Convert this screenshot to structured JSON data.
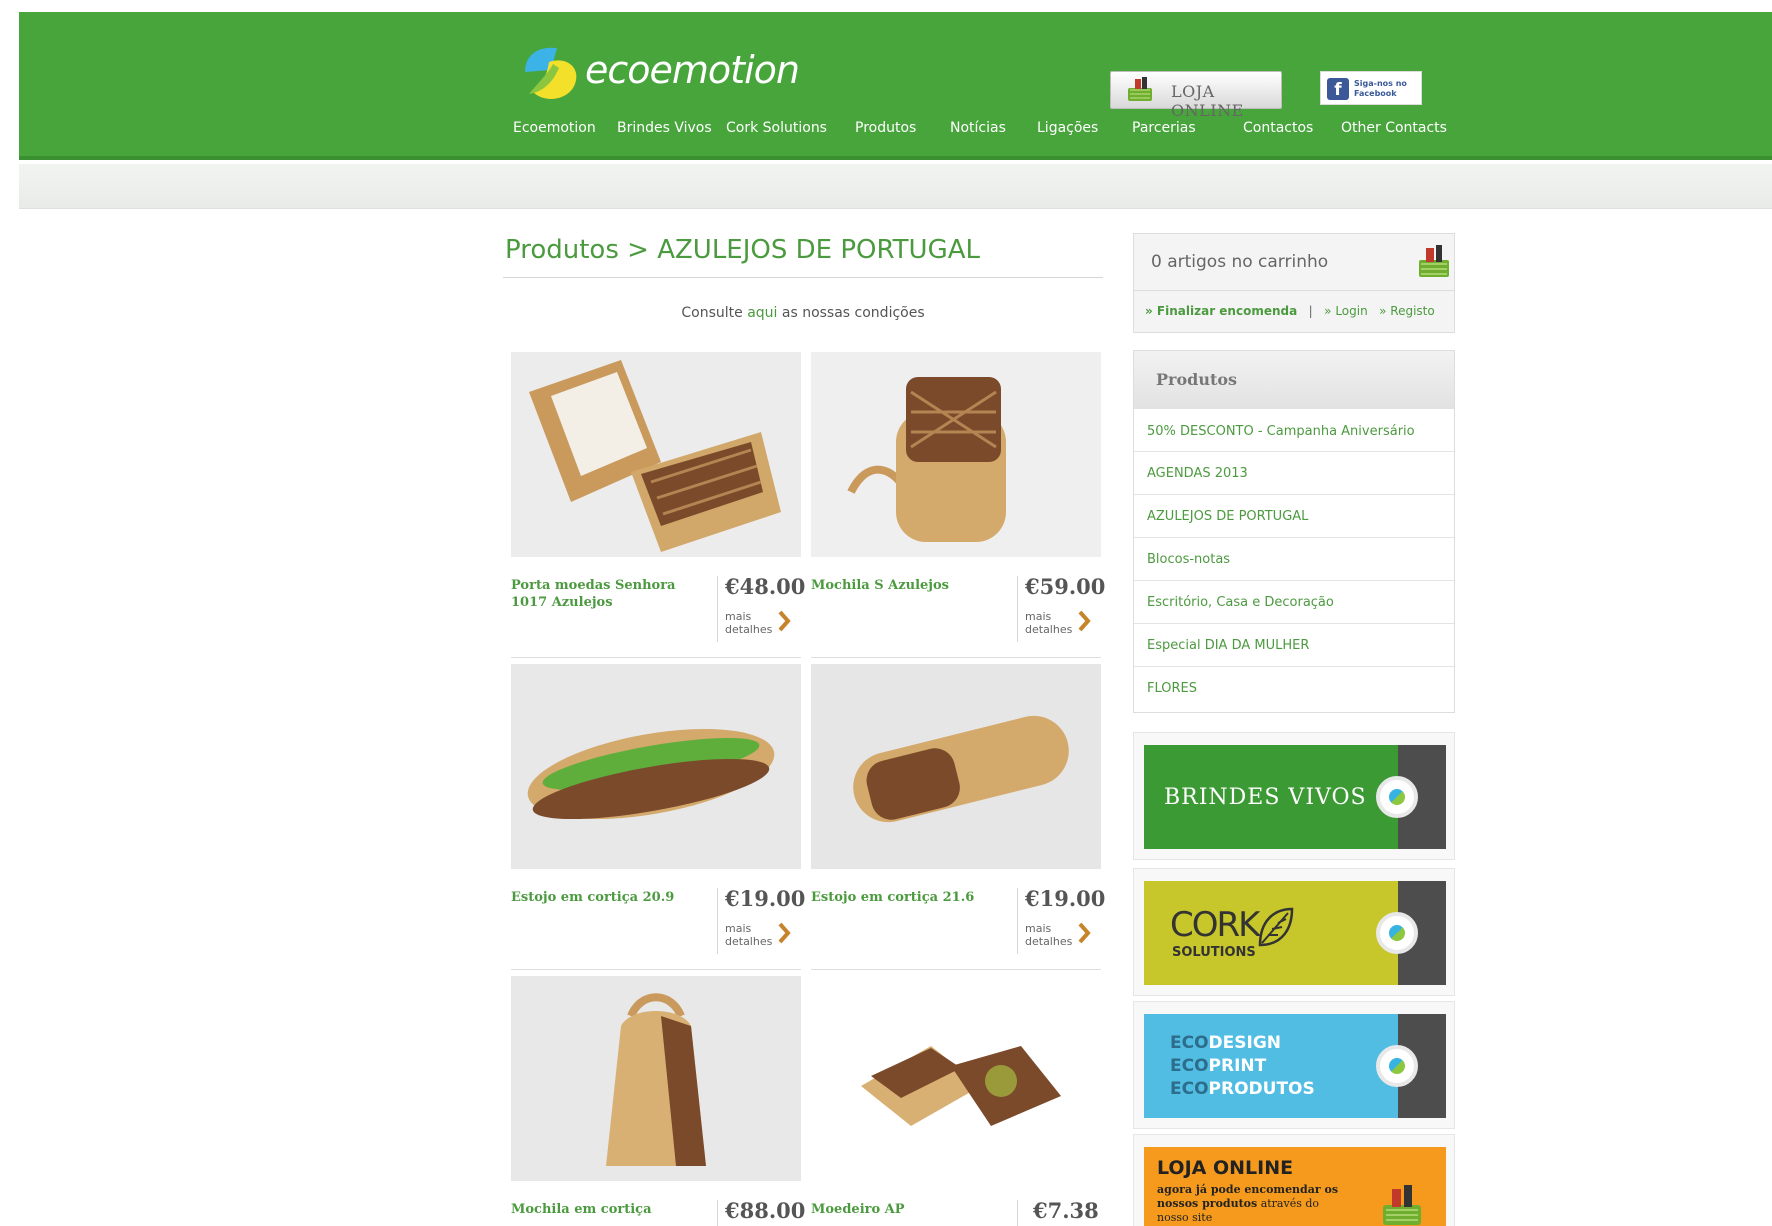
{
  "header": {
    "logo_text": "ecoemotion",
    "shop_button_label": "LOJA ONLINE",
    "facebook_label": "Siga-nos no Facebook",
    "nav": [
      "Ecoemotion",
      "Brindes Vivos",
      "Cork Solutions",
      "Produtos",
      "Notícias",
      "Ligações",
      "Parcerias",
      "Contactos",
      "Other Contacts"
    ]
  },
  "main": {
    "title": "Produtos > AZULEJOS DE PORTUGAL",
    "conditions_before": "Consulte ",
    "conditions_link": "aqui",
    "conditions_after": " as nossas condições",
    "more_label": "mais detalhes",
    "products": [
      {
        "name": "Porta moedas Senhora 1017 Azulejos",
        "price": "€48.00",
        "icon": "wallet"
      },
      {
        "name": "Mochila S Azulejos",
        "price": "€59.00",
        "icon": "backpack-small"
      },
      {
        "name": "Estojo em cortiça 20.9",
        "price": "€19.00",
        "icon": "pencil-case-open"
      },
      {
        "name": "Estojo em cortiça 21.6",
        "price": "€19.00",
        "icon": "pencil-case"
      },
      {
        "name": "Mochila em cortiça",
        "price": "€88.00",
        "icon": "backpack"
      },
      {
        "name": "Moedeiro AP",
        "price": "€7.38",
        "icon": "coin-purse"
      }
    ]
  },
  "sidebar": {
    "cart_count": "0 artigos no carrinho",
    "checkout": "» Finalizar encomenda",
    "separator": "|",
    "login": "» Login",
    "register": "» Registo",
    "categories_title": "Produtos",
    "categories": [
      "50% DESCONTO - Campanha Aniversário",
      "AGENDAS 2013",
      "AZULEJOS DE PORTUGAL",
      "Blocos-notas",
      "Escritório, Casa e Decoração",
      "Especial DIA DA MULHER",
      "FLORES"
    ],
    "banners": {
      "brindes": "BRINDES VIVOS",
      "cork_big": "CORK",
      "cork_small": "SOLUTIONS",
      "eco_prefix": "ECO",
      "eco_lines": [
        "DESIGN",
        "PRINT",
        "PRODUTOS"
      ],
      "shop_title": "LOJA ONLINE",
      "shop_line1": "agora já pode encomendar os",
      "shop_line2_bold": "nossos produtos",
      "shop_line2_rest": " através do",
      "shop_line3": "nosso site"
    }
  },
  "colors": {
    "header_green": "#47a53b",
    "link_green": "#4c9a3f",
    "brindes_green": "#3c9a35",
    "cork_yellow": "#c7c62a",
    "eco_blue": "#52bde3",
    "shop_orange": "#f59a1c"
  }
}
